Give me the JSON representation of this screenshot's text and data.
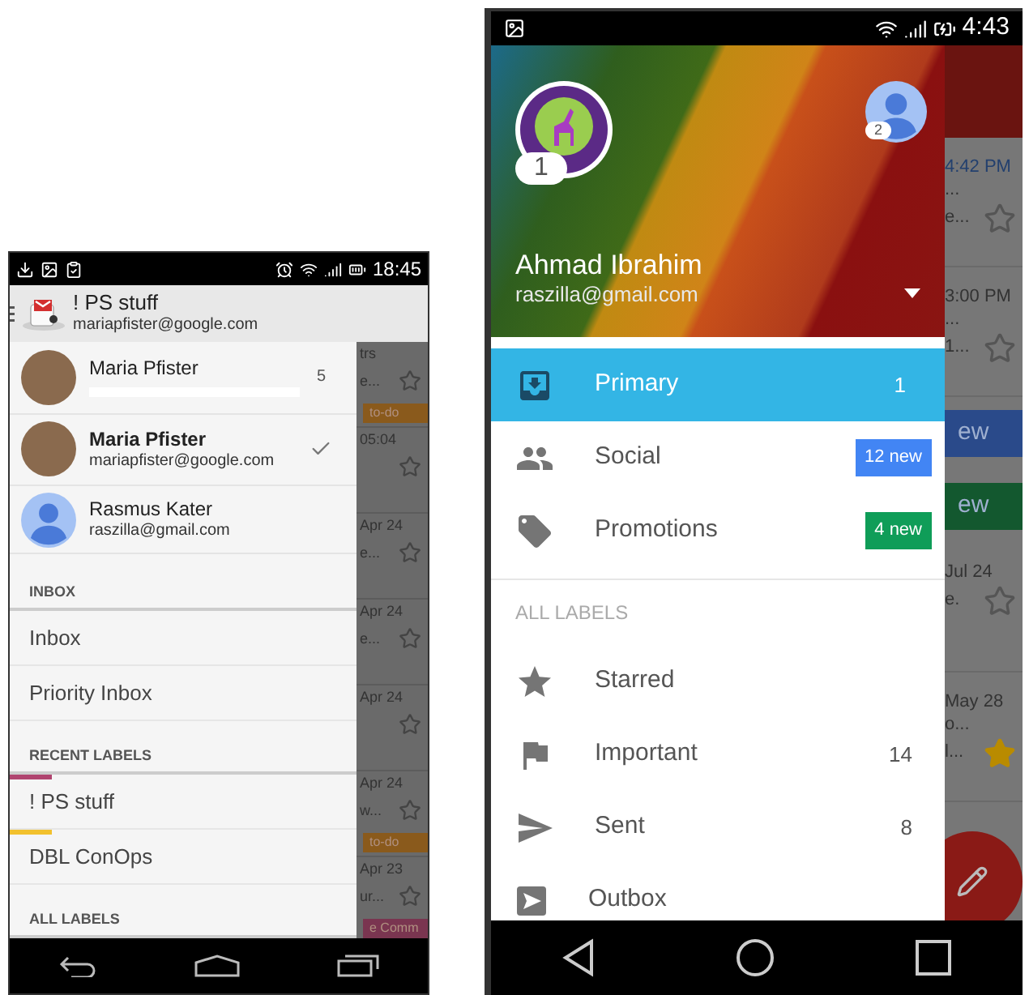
{
  "left_phone": {
    "status_bar": {
      "time": "18:45"
    },
    "action_bar": {
      "title": "! PS stuff",
      "subtitle": "mariapfister@google.com"
    },
    "accounts": [
      {
        "kind": "photo",
        "name": "Maria Pfister",
        "email_hidden": true,
        "count": "5",
        "selected": false
      },
      {
        "kind": "photo",
        "name": "Maria Pfister",
        "email": "mariapfister@google.com",
        "email_hidden": false,
        "selected": true
      },
      {
        "kind": "silhouette",
        "name": "Rasmus Kater",
        "email": "raszilla@gmail.com",
        "email_hidden": false,
        "selected": false
      }
    ],
    "sections": [
      {
        "header": "INBOX",
        "items": [
          {
            "label": "Inbox"
          },
          {
            "label": "Priority Inbox"
          }
        ]
      },
      {
        "header": "RECENT LABELS",
        "items": [
          {
            "label": "! PS stuff",
            "color": "#b0446f"
          },
          {
            "label": "DBL ConOps",
            "color": "#f2c12e"
          }
        ]
      },
      {
        "header": "ALL LABELS"
      }
    ],
    "mail_list": [
      {
        "lines": [
          "trs",
          "e..."
        ],
        "starred": false,
        "tag": {
          "label": "to-do",
          "color": "#8a5a1c"
        }
      },
      {
        "lines": [
          "05:04"
        ],
        "starred": false
      },
      {
        "lines": [
          "Apr 24",
          "e..."
        ],
        "starred": false
      },
      {
        "lines": [
          "Apr 24",
          "e..."
        ],
        "starred": false
      },
      {
        "lines": [
          "Apr 24"
        ],
        "starred": false
      },
      {
        "lines": [
          "Apr 24",
          "w..."
        ],
        "starred": false,
        "tag": {
          "label": "to-do",
          "color": "#8a5a1c"
        }
      },
      {
        "lines": [
          "Apr 23",
          "ur..."
        ],
        "starred": false,
        "tag": {
          "label": "e Comm",
          "color": "#7a3550"
        }
      }
    ]
  },
  "right_phone": {
    "status_bar": {
      "time": "4:43"
    },
    "header": {
      "name": "Ahmad Ibrahim",
      "email": "raszilla@gmail.com",
      "avatars": [
        {
          "kind": "logo",
          "badge": "1"
        },
        {
          "kind": "silhouette",
          "badge": "2"
        }
      ]
    },
    "tabs": [
      {
        "kind": "primary",
        "label": "Primary",
        "selected": true,
        "count": "1"
      },
      {
        "kind": "social",
        "label": "Social",
        "selected": false,
        "badge": {
          "text": "12 new",
          "color": "#4285f4"
        }
      },
      {
        "kind": "promotions",
        "label": "Promotions",
        "selected": false,
        "badge": {
          "text": "4 new",
          "color": "#0f9d58"
        }
      }
    ],
    "labels_header": "ALL LABELS",
    "labels": [
      {
        "kind": "starred",
        "label": "Starred"
      },
      {
        "kind": "important",
        "label": "Important",
        "count": "14"
      },
      {
        "kind": "sent",
        "label": "Sent",
        "count": "8"
      },
      {
        "kind": "outbox",
        "label": "Outbox"
      }
    ],
    "mail_list": [
      {
        "kind": "message",
        "lines": [
          "4:42 PM",
          "...",
          "e..."
        ],
        "unread": true,
        "starred": false
      },
      {
        "kind": "message",
        "lines": [
          "3:00 PM",
          "...",
          "1..."
        ],
        "unread": false,
        "starred": false
      },
      {
        "kind": "badge",
        "text": "ew",
        "color": "#2a4a8a"
      },
      {
        "kind": "badge",
        "text": "ew",
        "color": "#13582f"
      },
      {
        "kind": "message",
        "lines": [
          "Jul 24",
          "e."
        ],
        "unread": false,
        "starred": false
      },
      {
        "kind": "message",
        "lines": [
          "May 28",
          "o...",
          "l..."
        ],
        "unread": false,
        "starred": true
      }
    ]
  }
}
